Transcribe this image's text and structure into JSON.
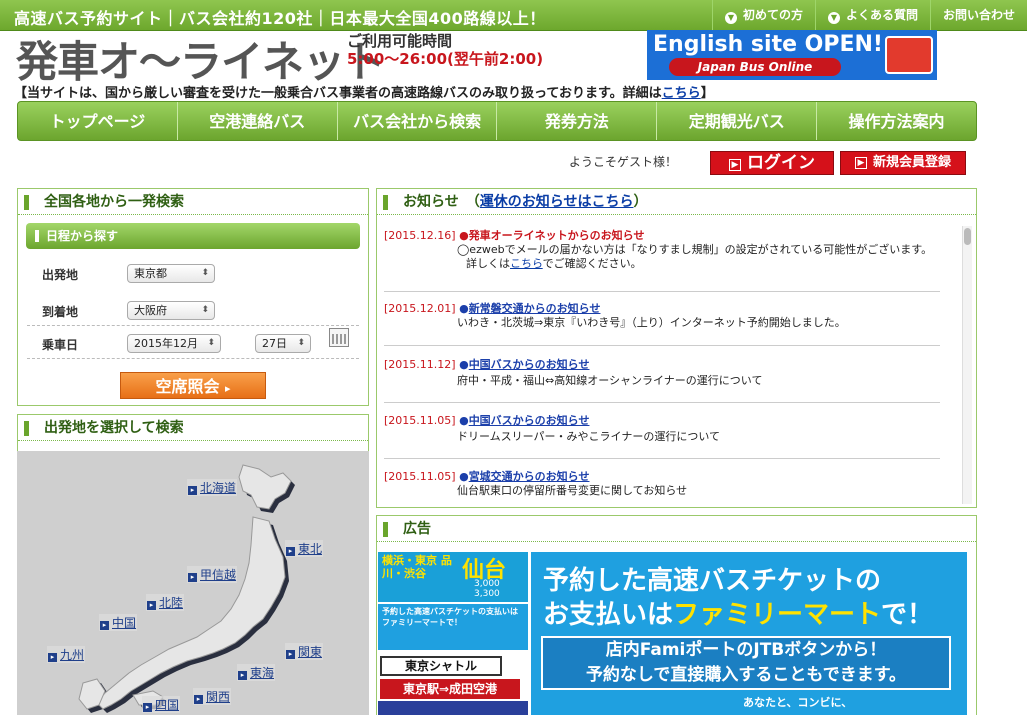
{
  "topbar": {
    "tagline": "高速バス予約サイト｜バス会社約120社｜日本最大全国400路線以上！",
    "links": [
      "初めての方",
      "よくある質問",
      "お問い合わせ"
    ]
  },
  "logo": "発車オ〜ライネット",
  "hours": {
    "label": "ご利用可能時間",
    "value": "5:00〜26:00(翌午前2:00)"
  },
  "english_banner": {
    "title": "English site OPEN!",
    "subtitle": "Japan Bus Online"
  },
  "notice": {
    "text": "【当サイトは、国から厳しい審査を受けた一般乗合バス事業者の高速路線バスのみ取り扱っております。詳細は",
    "link": "こちら",
    "end": "】"
  },
  "nav": [
    "トップページ",
    "空港連絡バス",
    "バス会社から検索",
    "発券方法",
    "定期観光バス",
    "操作方法案内"
  ],
  "welcome": "ようこそゲスト様！",
  "login_label": "ログイン",
  "register_label": "新規会員登録",
  "search": {
    "title": "全国各地から一発検索",
    "subtitle": "日程から探す",
    "departure_label": "出発地",
    "departure_value": "東京都",
    "arrival_label": "到着地",
    "arrival_value": "大阪府",
    "date_label": "乗車日",
    "month_value": "2015年12月",
    "day_value": "27日",
    "button": "空席照会"
  },
  "map": {
    "title": "出発地を選択して検索",
    "regions": [
      "北海道",
      "東北",
      "甲信越",
      "北陸",
      "中国",
      "関東",
      "九州",
      "東海",
      "関西",
      "四国"
    ]
  },
  "news": {
    "title": "お知らせ",
    "link_prefix": "（",
    "link": "運休のお知らせはこちら",
    "link_suffix": "）",
    "items": [
      {
        "date": "[2015.12.16]",
        "title": "発車オーライネットからのお知らせ",
        "body1": "◯ezwebでメールの届かない方は「なりすまし規制」の設定がされている可能性がございます。",
        "body2_pre": "詳しくは",
        "body2_link": "こちら",
        "body2_post": "でご確認ください。"
      },
      {
        "date": "[2015.12.01]",
        "title": "新常磐交通からのお知らせ",
        "body1": "いわき・北茨城⇒東京『いわき号』（上り）インターネット予約開始しました。"
      },
      {
        "date": "[2015.11.12]",
        "title": "中国バスからのお知らせ",
        "body1": "府中・平成・福山⇔高知線オーシャンライナーの運行について"
      },
      {
        "date": "[2015.11.05]",
        "title": "中国バスからのお知らせ",
        "body1": "ドリームスリーパー・みやこライナーの運行について"
      },
      {
        "date": "[2015.11.05]",
        "title": "宮城交通からのお知らせ",
        "body1": "仙台駅東口の停留所番号変更に関してお知らせ"
      }
    ]
  },
  "ad": {
    "title": "広告",
    "left": {
      "dest": "仙台",
      "stations": "横浜・東京 品川・渋谷",
      "price1": "3,000",
      "price2": "3,300",
      "famima_text": "予約した高速バスチケットの支払いはファミリーマートで！",
      "shuttle": "東京シャトル",
      "route": "東京駅⇒成田空港"
    },
    "right": {
      "line1": "予約した高速バスチケットの",
      "line2a": "お支払いは",
      "line2b": "ファミリーマート",
      "line2c": "で！",
      "box1": "店内FamiポートのJTBボタンから！",
      "box2": "予約なしで直接購入することもできます。",
      "footer": "あなたと、コンビに、"
    }
  }
}
